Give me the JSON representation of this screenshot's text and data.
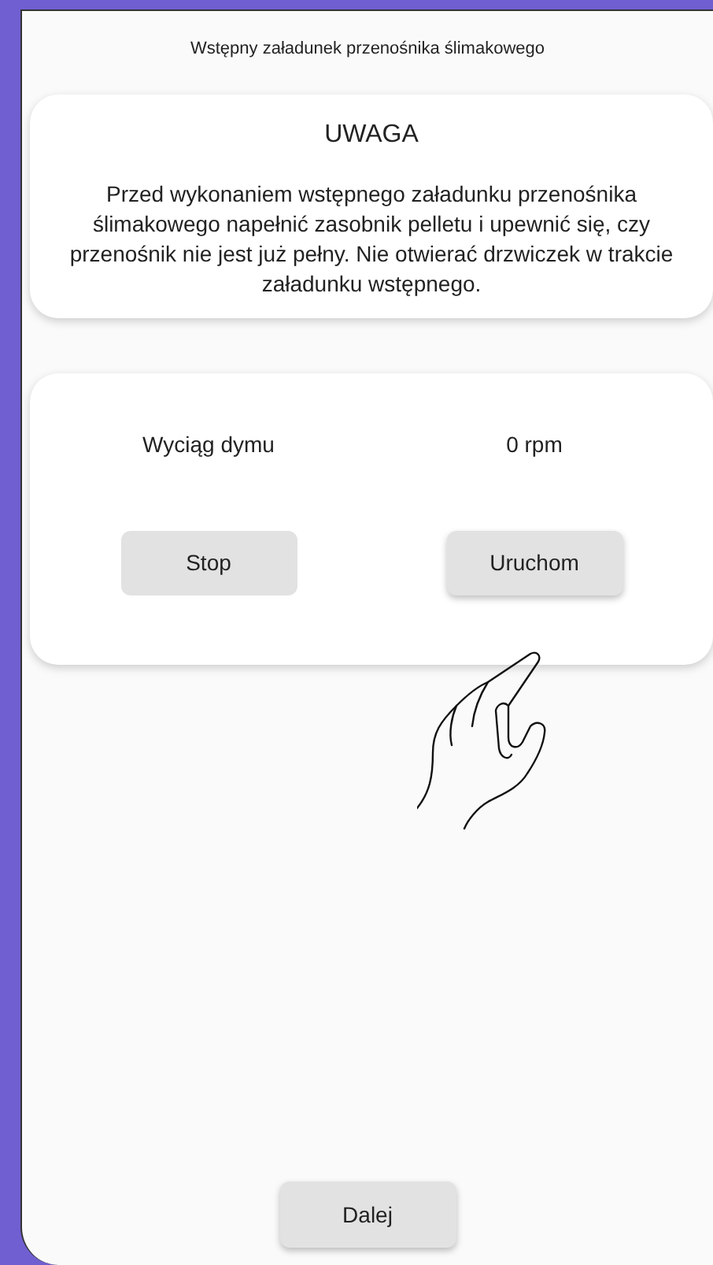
{
  "title": "Wstępny załadunek przenośnika ślimakowego",
  "warning": {
    "heading": "UWAGA",
    "body": "Przed wykonaniem wstępnego załadunku przenośnika ślimakowego napełnić zasobnik pelletu i upewnić się, czy przenośnik nie jest już pełny. Nie otwierać drzwiczek w trakcie załadunku wstępnego."
  },
  "device": {
    "label": "Wyciąg dymu",
    "reading": "0 rpm",
    "buttons": [
      {
        "label": "Stop",
        "kind": "flat"
      },
      {
        "label": "Uruchom",
        "kind": "raised"
      }
    ]
  },
  "next_button": {
    "label": "Dalej"
  }
}
